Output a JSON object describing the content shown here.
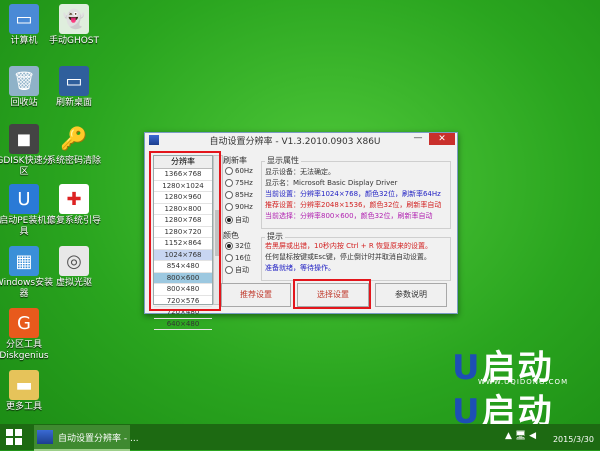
{
  "desktop_icons": [
    {
      "label": "计算机",
      "icon": "computer-icon"
    },
    {
      "label": "手动GHOST",
      "icon": "ghost-icon"
    },
    {
      "label": "回收站",
      "icon": "recycle-bin-icon"
    },
    {
      "label": "刷新桌面",
      "icon": "monitor-icon"
    },
    {
      "label": "GDISK快速分区",
      "icon": "gdisk-icon"
    },
    {
      "label": "系统密码清除",
      "icon": "key-icon"
    },
    {
      "label": "U启动PE装机工具",
      "icon": "u-install-icon"
    },
    {
      "label": "修复系统引导",
      "icon": "first-aid-icon"
    },
    {
      "label": "Windows安装器",
      "icon": "windows-installer-icon"
    },
    {
      "label": "虚拟光驱",
      "icon": "virtual-drive-icon"
    },
    {
      "label": "分区工具Diskgenius",
      "icon": "diskgenius-icon"
    },
    {
      "label": "更多工具",
      "icon": "folder-icon"
    }
  ],
  "window": {
    "title": "自动设置分辨率 - V1.3.2010.0903 X86U",
    "close": "✕",
    "minimize": "—",
    "res_header": "分辨率",
    "resolutions": [
      "1366×768",
      "1280×1024",
      "1280×960",
      "1280×800",
      "1280×768",
      "1280×720",
      "1152×864",
      "1024×768",
      "854×480",
      "800×600",
      "800×480",
      "720×576",
      "720×480",
      "640×480"
    ],
    "refresh_label": "刷新率",
    "refresh_options": [
      "60Hz",
      "75Hz",
      "85Hz",
      "90Hz",
      "自动"
    ],
    "color_label": "颜色",
    "color_options": [
      "32位",
      "16位",
      "自动"
    ],
    "display_label": "显示属性",
    "display_device": "显示设备：无法确定。",
    "display_name": "显示名：Microsoft Basic Display Driver",
    "current_setting": "当前设置：分辨率1024×768，颜色32位，刷新率64Hz",
    "recommended_setting": "推荐设置：分辨率2048×1536，颜色32位，刷新率自动",
    "current_choice": "当前选择：分辨率800×600，颜色32位，刷新率自动",
    "tips_label": "提示",
    "tip1": "若黑屏或出错，10秒内按 Ctrl + R 恢复原来的设置。",
    "tip2": "任何鼠标按键或Esc键，停止倒计时并取消自动设置。",
    "tip3": "准备就绪，等待操作。",
    "btn_recommend": "推荐设置",
    "btn_select": "选择设置",
    "btn_params": "参数说明"
  },
  "logo": {
    "text": "U启动",
    "url": "WWW.UQIDONG.COM"
  },
  "taskbar": {
    "task_label": "自动设置分辨率 - ...",
    "time": "2015/3/30",
    "clock_prefix": "▲ 🖥 ◀"
  },
  "colors": {
    "accent_red": "#e3161c",
    "desktop_green": "#2aa51f"
  }
}
